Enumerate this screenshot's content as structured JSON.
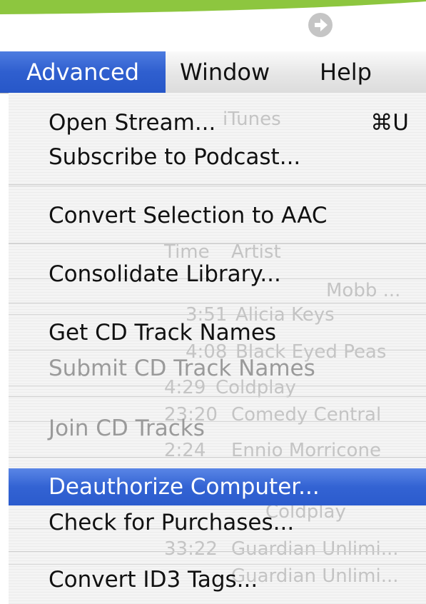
{
  "colors": {
    "top_bar_green": "#8dc63f",
    "menu_highlight": "#3363d3",
    "active_menu_title": "#2f5fcf",
    "disabled_text": "#9a9a9a"
  },
  "top": {
    "arrow_icon": "right-arrow-circle-icon"
  },
  "menubar": {
    "items": [
      "Advanced",
      "Window",
      "Help"
    ],
    "active": "Advanced"
  },
  "menu": {
    "items": [
      {
        "label": "Open Stream...",
        "shortcut": "⌘U",
        "enabled": true
      },
      {
        "label": "Subscribe to Podcast...",
        "shortcut": "",
        "enabled": true
      },
      {
        "label": "Convert Selection to AAC",
        "shortcut": "",
        "enabled": true
      },
      {
        "label": "Consolidate Library...",
        "shortcut": "",
        "enabled": true
      },
      {
        "label": "Get CD Track Names",
        "shortcut": "",
        "enabled": true
      },
      {
        "label": "Submit CD Track Names",
        "shortcut": "",
        "enabled": false
      },
      {
        "label": "Join CD Tracks",
        "shortcut": "",
        "enabled": false
      },
      {
        "label": "Deauthorize Computer...",
        "shortcut": "",
        "enabled": true,
        "highlighted": true
      },
      {
        "label": "Check for Purchases...",
        "shortcut": "",
        "enabled": true
      },
      {
        "label": "Convert ID3 Tags...",
        "shortcut": "",
        "enabled": true
      }
    ]
  },
  "background_window": {
    "title": "iTunes",
    "header_time": "Time",
    "header_artist": "Artist",
    "rows": [
      {
        "time": "",
        "artist": "Mobb ..."
      },
      {
        "time": "3:51",
        "artist": "Alicia Keys"
      },
      {
        "time": "4:08",
        "artist": "Black Eyed Peas"
      },
      {
        "time": "4:29",
        "artist": "Coldplay"
      },
      {
        "time": "23:20",
        "artist": "Comedy Central"
      },
      {
        "time": "2:24",
        "artist": "Ennio Morricone"
      },
      {
        "time": "",
        "artist": "Coldplay"
      },
      {
        "time": "33:22",
        "artist": "Guardian Unlimi..."
      },
      {
        "time": "",
        "artist": "Guardian Unlimi..."
      }
    ]
  }
}
